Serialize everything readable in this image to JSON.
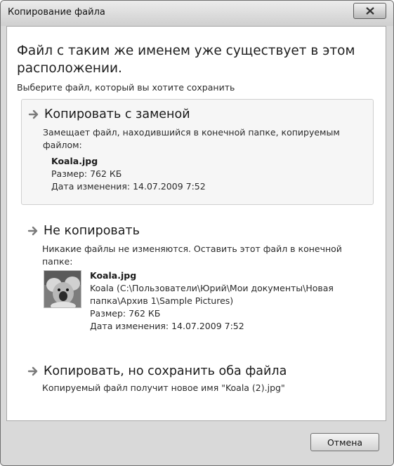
{
  "window": {
    "title": "Копирование файла"
  },
  "dialog": {
    "heading": "Файл с таким же именем уже существует в этом расположении.",
    "subheading": "Выберите файл, который вы хотите сохранить"
  },
  "options": [
    {
      "title": "Копировать с заменой",
      "description": "Замещает файл, находившийся в конечной папке, копируемым файлом:",
      "file": {
        "name": "Koala.jpg",
        "size": "Размер: 762 КБ",
        "modified": "Дата изменения: 14.07.2009 7:52"
      }
    },
    {
      "title": "Не копировать",
      "description": "Никакие файлы не изменяются. Оставить этот файл в конечной папке:",
      "file": {
        "name": "Koala.jpg",
        "path": "Koala (C:\\Пользователи\\Юрий\\Мои документы\\Новая папка\\Архив 1\\Sample Pictures)",
        "size": "Размер: 762 КБ",
        "modified": "Дата изменения: 14.07.2009 7:52"
      }
    },
    {
      "title": "Копировать, но сохранить оба файла",
      "description": "Копируемый файл получит новое имя \"Koala (2).jpg\""
    }
  ],
  "footer": {
    "cancel_label": "Отмена"
  },
  "icons": {
    "close": "close-icon",
    "option_arrow": "arrow-right-icon",
    "thumbnail": "koala-thumbnail"
  }
}
